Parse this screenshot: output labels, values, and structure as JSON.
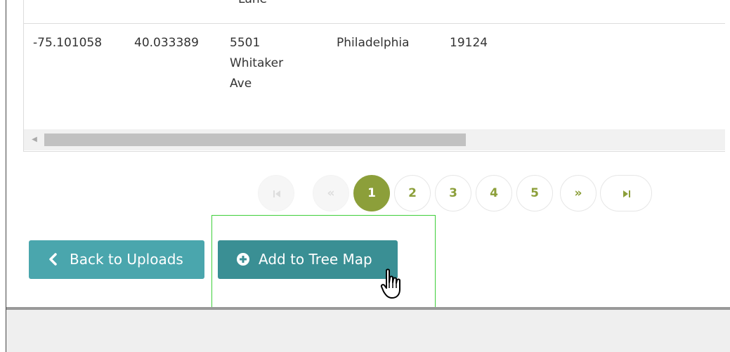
{
  "table": {
    "clipped_cell_text": "Lane",
    "row": {
      "longitude": "-75.101058",
      "latitude": "40.033389",
      "address_lines": [
        "5501",
        "Whitaker",
        "Ave"
      ],
      "city": "Philadelphia",
      "zip": "19124"
    }
  },
  "pagination": {
    "first_icon": "first-page-icon",
    "prev_label": "«",
    "pages": [
      "1",
      "2",
      "3",
      "4",
      "5"
    ],
    "current_page": "1",
    "next_label": "»",
    "last_icon": "last-page-icon"
  },
  "buttons": {
    "back_label": "Back to Uploads",
    "back_icon": "chevron-left-icon",
    "add_label": "Add to Tree Map",
    "add_icon": "plus-circle-icon"
  },
  "colors": {
    "accent_green": "#8c9f3a",
    "button_teal": "#4aa6ad",
    "button_teal_hover": "#3a8f94",
    "highlight": "#3ecf3a"
  }
}
